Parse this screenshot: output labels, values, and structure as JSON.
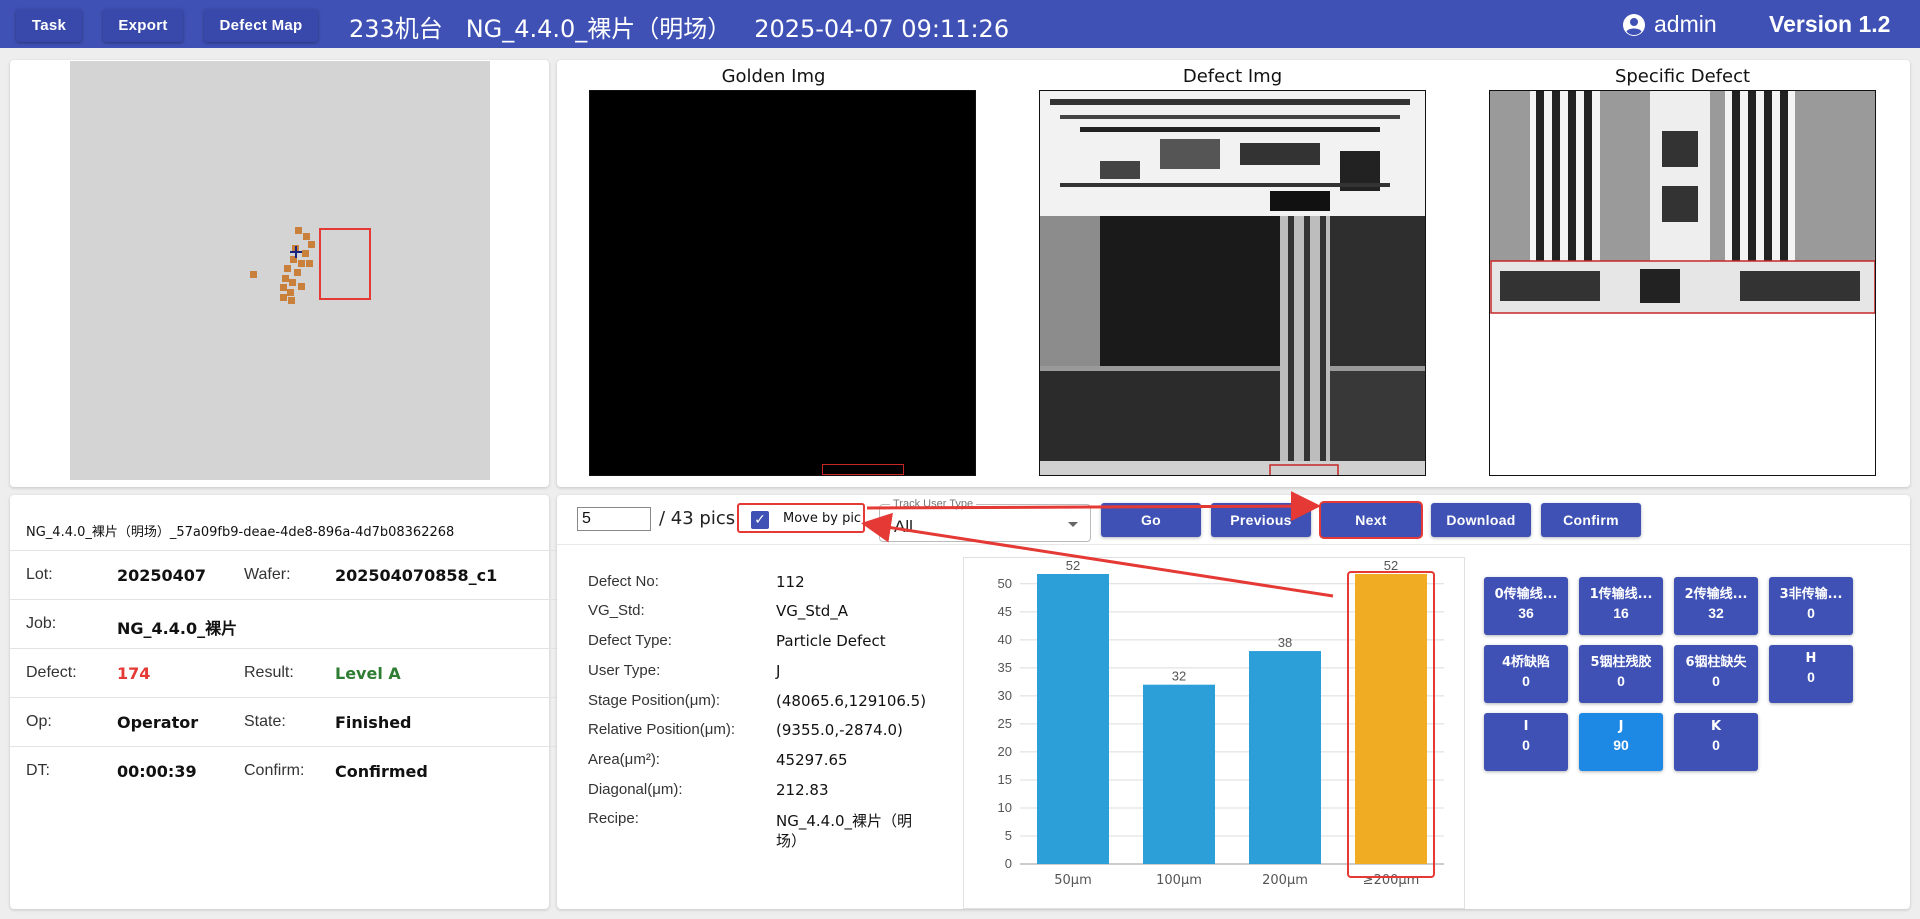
{
  "header": {
    "task_label": "Task",
    "export_label": "Export",
    "defect_map_label": "Defect Map",
    "title": "233机台   NG_4.4.0_裸片（明场）   2025-04-07 09:11:26",
    "user": "admin",
    "version": "Version 1.2"
  },
  "images": {
    "golden_title": "Golden Img",
    "defect_title": "Defect Img",
    "specific_title": "Specific Defect"
  },
  "info": {
    "id": "NG_4.4.0_裸片（明场）_57a09fb9-deae-4de8-896a-4d7b08362268",
    "lot_label": "Lot:",
    "lot": "20250407",
    "wafer_label": "Wafer:",
    "wafer": "202504070858_c1",
    "job_label": "Job:",
    "job": "NG_4.4.0_裸片",
    "defect_label": "Defect:",
    "defect": "174",
    "result_label": "Result:",
    "result": "Level A",
    "op_label": "Op:",
    "op": "Operator",
    "state_label": "State:",
    "state": "Finished",
    "dt_label": "DT:",
    "dt": "00:00:39",
    "confirm_label": "Confirm:",
    "confirm": "Confirmed"
  },
  "controls": {
    "page_value": "5",
    "page_total": "/ 43 pics",
    "move_by_pic": "Move by pic",
    "move_by_pic_checked": "✓",
    "track_label": "Track User Type",
    "track_value": "All",
    "go": "Go",
    "previous": "Previous",
    "next": "Next",
    "download": "Download",
    "confirm": "Confirm"
  },
  "defect": {
    "no_label": "Defect No:",
    "no": "112",
    "vg_label": "VG_Std:",
    "vg": "VG_Std_A",
    "type_label": "Defect Type:",
    "type": "Particle Defect",
    "user_type_label": "User Type:",
    "user_type": "J",
    "stage_label": "Stage Position(μm):",
    "stage": "(48065.6,129106.5)",
    "relative_label": "Relative Position(μm):",
    "relative": "(9355.0,-2874.0)",
    "area_label": "Area(μm²):",
    "area": "45297.65",
    "diagonal_label": "Diagonal(μm):",
    "diagonal": "212.83",
    "recipe_label": "Recipe:",
    "recipe_line1": "NG_4.4.0_裸片（明",
    "recipe_line2": "场）"
  },
  "chart_data": {
    "type": "bar",
    "categories": [
      "50μm",
      "100μm",
      "200μm",
      "≥200μm"
    ],
    "values": [
      52,
      32,
      38,
      52
    ],
    "ylim": [
      0,
      50
    ],
    "yticks": [
      0,
      5,
      10,
      15,
      20,
      25,
      30,
      35,
      40,
      45,
      50
    ],
    "highlight_index": 3,
    "grid": true,
    "colors": {
      "bar": "#2d9fd8",
      "highlight": "#f0ad24"
    }
  },
  "user_types": [
    {
      "name": "0传输线...",
      "count": "36"
    },
    {
      "name": "1传输线...",
      "count": "16"
    },
    {
      "name": "2传输线...",
      "count": "32"
    },
    {
      "name": "3非传输...",
      "count": "0"
    },
    {
      "name": "4桥缺陷",
      "count": "0"
    },
    {
      "name": "5铟柱残胶",
      "count": "0"
    },
    {
      "name": "6铟柱缺失",
      "count": "0"
    },
    {
      "name": "H",
      "count": "0"
    },
    {
      "name": "I",
      "count": "0"
    },
    {
      "name": "J",
      "count": "90"
    },
    {
      "name": "K",
      "count": "0"
    }
  ],
  "colors": {
    "header": "#3f51b5",
    "button": "#3f51b5",
    "active": "#1e88e5",
    "annotation": "#e53935",
    "defect_count": "#e53935",
    "result": "#2e7d32"
  }
}
